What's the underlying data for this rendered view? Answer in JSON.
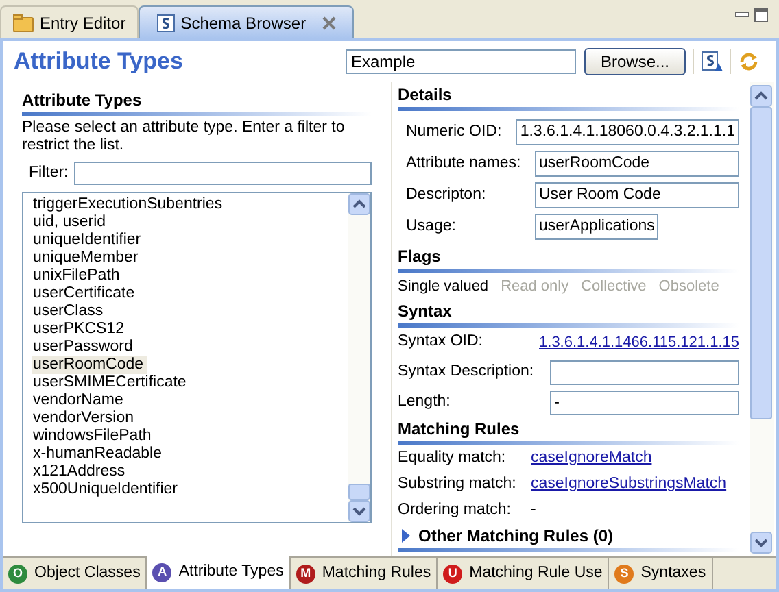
{
  "editor_tabs": [
    {
      "label": "Entry Editor",
      "selected": false,
      "closable": false
    },
    {
      "label": "Schema Browser",
      "selected": true,
      "closable": true
    }
  ],
  "header": {
    "title": "Attribute Types",
    "search_value": "Example",
    "browse_button": "Browse..."
  },
  "list_panel": {
    "title": "Attribute Types",
    "description": "Please select an attribute type. Enter a filter to restrict the list.",
    "filter_label": "Filter:",
    "items": [
      {
        "label": "triggerExecutionSubentries",
        "selected": false
      },
      {
        "label": "uid, userid",
        "selected": false
      },
      {
        "label": "uniqueIdentifier",
        "selected": false
      },
      {
        "label": "uniqueMember",
        "selected": false
      },
      {
        "label": "unixFilePath",
        "selected": false
      },
      {
        "label": "userCertificate",
        "selected": false
      },
      {
        "label": "userClass",
        "selected": false
      },
      {
        "label": "userPKCS12",
        "selected": false
      },
      {
        "label": "userPassword",
        "selected": false
      },
      {
        "label": "userRoomCode",
        "selected": true
      },
      {
        "label": "userSMIMECertificate",
        "selected": false
      },
      {
        "label": "vendorName",
        "selected": false
      },
      {
        "label": "vendorVersion",
        "selected": false
      },
      {
        "label": "windowsFilePath",
        "selected": false
      },
      {
        "label": "x-humanReadable",
        "selected": false
      },
      {
        "label": "x121Address",
        "selected": false
      },
      {
        "label": "x500UniqueIdentifier",
        "selected": false
      }
    ]
  },
  "details": {
    "title": "Details",
    "fields": [
      {
        "label": "Numeric OID:",
        "value": "1.3.6.1.4.1.18060.0.4.3.2.1.1.1"
      },
      {
        "label": "Attribute names:",
        "value": "userRoomCode"
      },
      {
        "label": "Descripton:",
        "value": "User Room Code"
      },
      {
        "label": "Usage:",
        "value": "userApplications"
      }
    ]
  },
  "flags": {
    "title": "Flags",
    "items": [
      {
        "label": "Single valued",
        "on": true
      },
      {
        "label": "Read only",
        "on": false
      },
      {
        "label": "Collective",
        "on": false
      },
      {
        "label": "Obsolete",
        "on": false
      }
    ]
  },
  "syntax": {
    "title": "Syntax",
    "rows": [
      {
        "kind": "link",
        "label": "Syntax OID:",
        "value": "1.3.6.1.4.1.1466.115.121.1.15"
      },
      {
        "kind": "field",
        "label": "Syntax Description:"
      },
      {
        "kind": "field",
        "label": "Length:",
        "value": "-"
      }
    ]
  },
  "matching_rules": {
    "title": "Matching Rules",
    "rows": [
      {
        "kind": "link",
        "label": "Equality match:",
        "value": "caseIgnoreMatch"
      },
      {
        "kind": "link",
        "label": "Substring match:",
        "value": "caseIgnoreSubstringsMatch"
      },
      {
        "kind": "text",
        "label": "Ordering match:",
        "value": "-"
      }
    ],
    "other_rules": {
      "label": "Other Matching Rules (0)",
      "expanded": false
    }
  },
  "bottom_tabs": [
    {
      "badge": "O",
      "label": "Object Classes",
      "color": "#2e8b3e",
      "selected": false
    },
    {
      "badge": "A",
      "label": "Attribute Types",
      "color": "#5a4fb0",
      "selected": true
    },
    {
      "badge": "M",
      "label": "Matching Rules",
      "color": "#b01c1c",
      "selected": false
    },
    {
      "badge": "U",
      "label": "Matching Rule Use",
      "color": "#d01c1c",
      "selected": false
    },
    {
      "badge": "S",
      "label": "Syntaxes",
      "color": "#e07a1c",
      "selected": false
    }
  ]
}
